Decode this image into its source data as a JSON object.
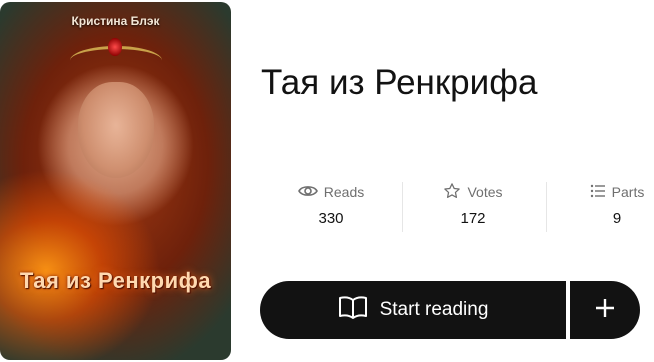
{
  "cover": {
    "author": "Кристина Блэк",
    "title": "Тая из Ренкрифа"
  },
  "story": {
    "title": "Тая из Ренкрифа"
  },
  "stats": [
    {
      "icon": "eye-icon",
      "label": "Reads",
      "value": "330"
    },
    {
      "icon": "star-icon",
      "label": "Votes",
      "value": "172"
    },
    {
      "icon": "list-icon",
      "label": "Parts",
      "value": "9"
    }
  ],
  "actions": {
    "start_label": "Start reading",
    "add_icon": "plus-icon"
  },
  "colors": {
    "button_bg": "#121212",
    "muted_text": "#6f6f6f"
  }
}
